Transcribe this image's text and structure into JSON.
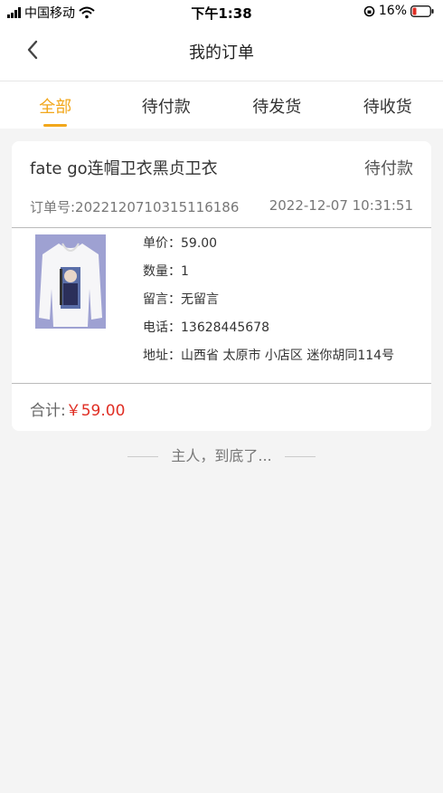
{
  "status_bar": {
    "carrier": "中国移动",
    "time": "下午1:38",
    "battery": "16%",
    "battery_color": "#e02e24"
  },
  "nav": {
    "title": "我的订单",
    "back_icon": "chevron-left-icon"
  },
  "tabs": [
    {
      "label": "全部",
      "active": true
    },
    {
      "label": "待付款",
      "active": false
    },
    {
      "label": "待发货",
      "active": false
    },
    {
      "label": "待收货",
      "active": false
    }
  ],
  "colors": {
    "accent": "#f2a71b",
    "price": "#e02e24"
  },
  "order": {
    "title": "fate go连帽卫衣黑贞卫衣",
    "status": "待付款",
    "order_no": "订单号:20221207103151​16186",
    "time": "2022-12-07 10:31:51",
    "details": [
      "单价：59.00",
      "数量：1",
      "留言：无留言",
      "电话：13628445678",
      "地址：山西省 太原市 小店区 迷你胡同114号"
    ],
    "total_label": "合计:",
    "total_amount": "￥59.00"
  },
  "footer": {
    "end_text": "主人，到底了..."
  }
}
